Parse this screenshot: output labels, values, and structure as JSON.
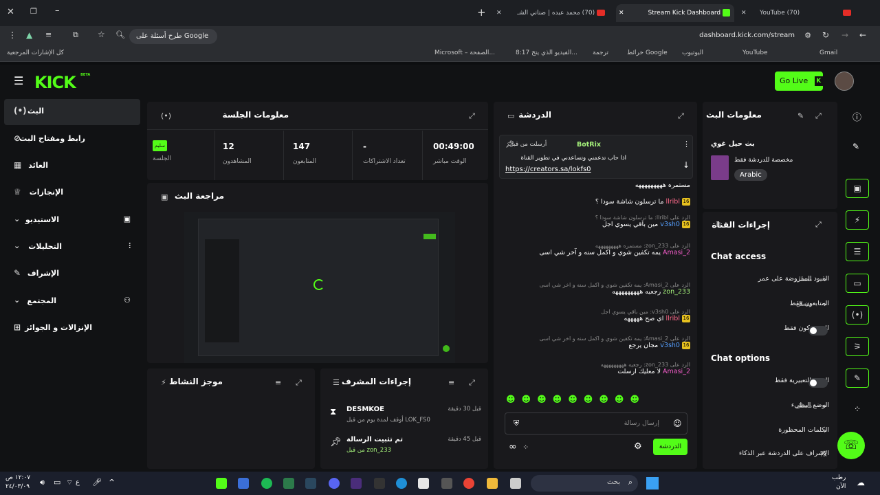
{
  "browser": {
    "tabs": [
      {
        "title": "(70) YouTube",
        "active": false
      },
      {
        "title": "Stream Kick Dashboard",
        "active": true
      },
      {
        "title": "(70) محمد عبده | ضناني الشـ",
        "active": false
      }
    ],
    "url": "dashboard.kick.com/stream",
    "search_pill": "طرح أسئلة على Google",
    "bookmarks": [
      "Gmail",
      "YouTube",
      "اليوتيوب",
      "خرائط Google",
      "ترجمة",
      "8:17 الفيديو الذي يتخ...",
      "Microsoft – الصفحة...",
      "كل الإشارات المرجعية"
    ]
  },
  "app": {
    "logo": "KICK",
    "logo_badge": "BETA",
    "go_live": "Go Live",
    "sidebar": [
      {
        "label": "البث",
        "icon": "live-icon",
        "active": true
      },
      {
        "label": "رابط ومفتاح البث",
        "icon": "link-icon"
      },
      {
        "label": "العائد",
        "icon": "revenue-icon"
      },
      {
        "label": "الإنجازات",
        "icon": "trophy-icon"
      },
      {
        "label": "الاستيديو",
        "icon": "studio-icon"
      },
      {
        "label": "التحليلات",
        "icon": "analytics-icon"
      },
      {
        "label": "الإشراف",
        "icon": "moderation-icon"
      },
      {
        "label": "المجتمع",
        "icon": "community-icon"
      },
      {
        "label": "الإنزالات و الجوائز",
        "icon": "drops-icon"
      }
    ]
  },
  "session": {
    "title": "معلومات الجلسة",
    "stats": [
      {
        "value": "00:49:00",
        "label": "الوقت مباشر"
      },
      {
        "value": "-",
        "label": "تعداد الاشتراكات"
      },
      {
        "value": "147",
        "label": "المتابعون"
      },
      {
        "value": "12",
        "label": "المشاهدون"
      },
      {
        "value": "سليم",
        "label": "الجلسة"
      }
    ]
  },
  "preview": {
    "title": "مراجعة البث"
  },
  "activity": {
    "title": "موجز النشاط"
  },
  "mod_actions": {
    "title": "إجراءات المشرف",
    "items": [
      {
        "user": "DESMKOE",
        "detail": "أوقف لمدة يوم من قبل LOK_FS0",
        "time": "قبل 30 دقيقة"
      },
      {
        "user": "تم تثبيت الرسالة",
        "detail": "من قبل zon_233",
        "time": "قبل 45 دقيقة"
      }
    ]
  },
  "chat": {
    "title": "الدردشة",
    "pinned": {
      "by": "أرسلت من قبل",
      "user": "BotRix",
      "text": "اذا حاب تدعمني وتساعدني في تطوير القناة",
      "link": "https://creators.sa/lokfs0"
    },
    "messages": [
      {
        "reply": "",
        "user": "",
        "text": "مستمره هههههههههه"
      },
      {
        "reply": "",
        "user": "llribl",
        "text": "ما ترسلون شاشة سودا ؟"
      },
      {
        "reply": "الرد على llribl: ما ترسلون شاشة سودا ؟",
        "user": "v3sh0",
        "text": "مين باقي يسوي اجل"
      },
      {
        "reply": "الرد على zon_233: مستمره هههههههههه",
        "user": "Amasi_2",
        "text": "يمه تكفين شوي و اكمل سنه و آخر شي اسى"
      },
      {
        "reply": "الرد على Amasi_2: يمه تكفين شوي و اكمل سنه و اخر شي اسى",
        "user": "zon_233",
        "text": "رجعيه هههههههههه"
      },
      {
        "reply": "الرد على v3sh0: مين باقي يسوي اجل",
        "user": "llribl",
        "text": "اي صح هههههه"
      },
      {
        "reply": "الرد على Amasi_2: يمه تكفين شوي و اكمل سنه و اخر شي اسى",
        "user": "v3sh0",
        "text": "مجان يرجع"
      },
      {
        "reply": "الرد على zon_233: رجعيه هههههههههه",
        "user": "Amasi_2",
        "text": "لا معليك ارسلت"
      }
    ],
    "input_placeholder": "إرسال رسالة",
    "send_label": "الدردشة"
  },
  "stream_info": {
    "title": "معلومات البث",
    "stream_title": "بث حيل غوي",
    "category": "مخصصة للدردشة فقط",
    "language": "Arabic"
  },
  "channel_actions": {
    "title": "إجراءات القناة",
    "chat_access": "Chat access",
    "rows_access": [
      {
        "label": "القيود المفروضة على عمر",
        "value": "معطل"
      },
      {
        "label": "المتابعون فقط",
        "value": "معطل"
      },
      {
        "label": "للمشتركون فقط",
        "value": ""
      }
    ],
    "chat_options": "Chat options",
    "rows_options": [
      {
        "label": "الصور التعبيرية فقط",
        "value": ""
      },
      {
        "label": "الوضع البطيء",
        "value": "معطل"
      },
      {
        "label": "الكلمات المحظورة",
        "value": ""
      },
      {
        "label": "الإشراف على الدردشة عبر الذكاء",
        "value": ""
      }
    ]
  },
  "taskbar": {
    "time": "١٢:٠٧ ص",
    "date": "٢٤/٠٣/٠٩",
    "weather": "رطب",
    "weather2": "الآن",
    "search": "بحث",
    "lang": "ع"
  },
  "colors": {
    "accent": "#53fc18",
    "bg": "#111214",
    "panel": "#19191c"
  }
}
